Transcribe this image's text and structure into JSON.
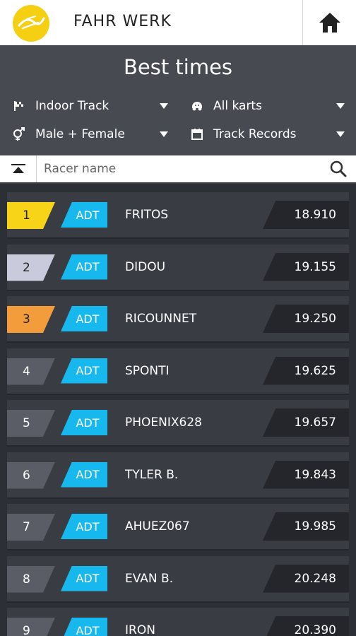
{
  "app": {
    "brand": "FAHR WERK"
  },
  "page": {
    "title": "Best times"
  },
  "filters": [
    {
      "icon": "flag-icon",
      "label": "Indoor Track"
    },
    {
      "icon": "kart-icon",
      "label": "All karts"
    },
    {
      "icon": "gender-icon",
      "label": "Male + Female"
    },
    {
      "icon": "calendar-icon",
      "label": "Track Records"
    }
  ],
  "search": {
    "placeholder": "Racer name",
    "value": ""
  },
  "colors": {
    "gold": "#f7d417",
    "silver": "#c9cbdc",
    "bronze": "#f39c3c",
    "other": "#5b5d66",
    "badge": "#16b8ee"
  },
  "results": [
    {
      "rank": "1",
      "category": "ADT",
      "name": "FRITOS",
      "time": "18.910"
    },
    {
      "rank": "2",
      "category": "ADT",
      "name": "DIDOU",
      "time": "19.155"
    },
    {
      "rank": "3",
      "category": "ADT",
      "name": "RICOUNNET",
      "time": "19.250"
    },
    {
      "rank": "4",
      "category": "ADT",
      "name": "SPONTI",
      "time": "19.625"
    },
    {
      "rank": "5",
      "category": "ADT",
      "name": "PHOENIX628",
      "time": "19.657"
    },
    {
      "rank": "6",
      "category": "ADT",
      "name": "TYLER B.",
      "time": "19.843"
    },
    {
      "rank": "7",
      "category": "ADT",
      "name": "AHUEZ067",
      "time": "19.985"
    },
    {
      "rank": "8",
      "category": "ADT",
      "name": "EVAN B.",
      "time": "20.248"
    },
    {
      "rank": "9",
      "category": "ADT",
      "name": "IRON",
      "time": "20.390"
    }
  ]
}
